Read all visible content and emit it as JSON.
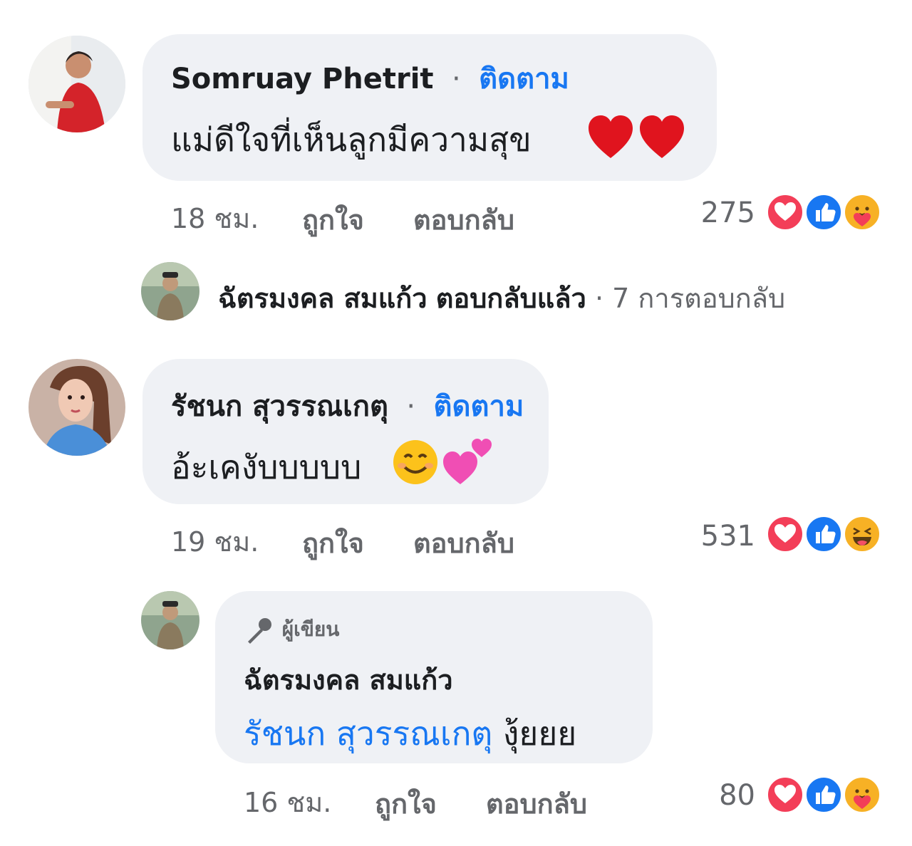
{
  "comments": [
    {
      "author": "Somruay Phetrit",
      "follow": "ติดตาม",
      "text": "แม่ดีใจที่เห็นลูกมีความสุข",
      "time": "18 ชม.",
      "like": "ถูกใจ",
      "reply": "ตอบกลับ",
      "reaction_count": "275",
      "reactions": [
        "heart-icon",
        "like-icon",
        "care-icon"
      ]
    },
    {
      "author": "รัชนก สุวรรณเกตุ",
      "follow": "ติดตาม",
      "text": "อ้ะเคงับบบบบ",
      "time": "19 ชม.",
      "like": "ถูกใจ",
      "reply": "ตอบกลับ",
      "reaction_count": "531",
      "reactions": [
        "heart-icon",
        "like-icon",
        "haha-icon"
      ]
    }
  ],
  "reply_summary": {
    "author": "ฉัตรมงคล สมแก้ว",
    "action": "ตอบกลับแล้ว",
    "count": "7 การตอบกลับ"
  },
  "author_reply": {
    "badge": "ผู้เขียน",
    "badge_icon": "microphone-icon",
    "author": "ฉัตรมงคล สมแก้ว",
    "mention": "รัชนก สุวรรณเกตุ",
    "text": "งุ้ยยย",
    "time": "16 ชม.",
    "like": "ถูกใจ",
    "reply": "ตอบกลับ",
    "reaction_count": "80",
    "reactions": [
      "heart-icon",
      "like-icon",
      "care-icon"
    ]
  },
  "colors": {
    "bubble": "#eff1f5",
    "link": "#1877f2",
    "secondary": "#65676b",
    "heart": "#f33e58",
    "like": "#1877f2"
  }
}
